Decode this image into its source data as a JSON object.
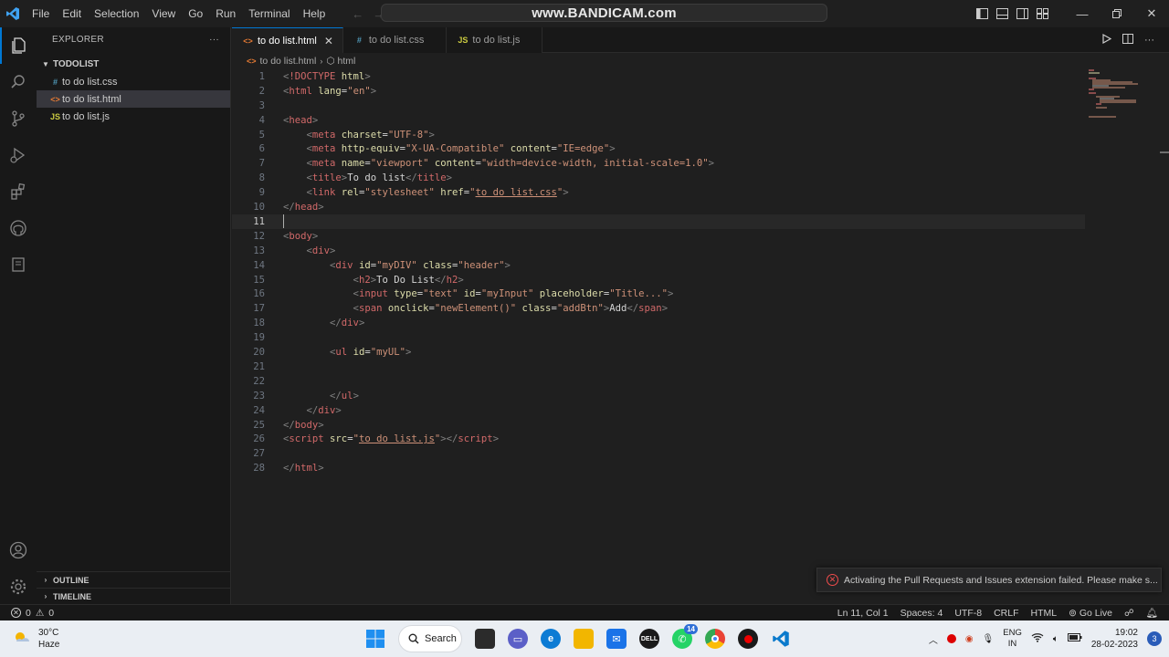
{
  "titlebar": {
    "menu": [
      "File",
      "Edit",
      "Selection",
      "View",
      "Go",
      "Run",
      "Terminal",
      "Help"
    ],
    "command_center": "www.BANDICAM.com"
  },
  "sidebar": {
    "title": "EXPLORER",
    "more": "···",
    "folder": "TODOLIST",
    "files": [
      {
        "name": "to do list.css",
        "type": "css",
        "icon": "#"
      },
      {
        "name": "to do list.html",
        "type": "html",
        "icon": "<>"
      },
      {
        "name": "to do list.js",
        "type": "js",
        "icon": "JS"
      }
    ],
    "outline": "OUTLINE",
    "timeline": "TIMELINE"
  },
  "tabs": [
    {
      "label": "to do list.html",
      "icon": "<>",
      "active": true
    },
    {
      "label": "to do list.css",
      "icon": "#",
      "active": false
    },
    {
      "label": "to do list.js",
      "icon": "JS",
      "active": false
    }
  ],
  "breadcrumb": {
    "file": "to do list.html",
    "node": "html"
  },
  "editor": {
    "current_line": 11,
    "lines": [
      {
        "n": "1",
        "tokens": [
          [
            "p",
            "<"
          ],
          [
            "d",
            "!DOCTYPE"
          ],
          [
            "a",
            " html"
          ],
          [
            "p",
            ">"
          ]
        ]
      },
      {
        "n": "2",
        "tokens": [
          [
            "p",
            "<"
          ],
          [
            "t",
            "html"
          ],
          [
            "a",
            " lang"
          ],
          [
            "x",
            "="
          ],
          [
            "s",
            "\"en\""
          ],
          [
            "p",
            ">"
          ]
        ]
      },
      {
        "n": "3",
        "tokens": []
      },
      {
        "n": "4",
        "tokens": [
          [
            "p",
            "<"
          ],
          [
            "t",
            "head"
          ],
          [
            "p",
            ">"
          ]
        ]
      },
      {
        "n": "5",
        "tokens": [
          [
            "x",
            "    "
          ],
          [
            "p",
            "<"
          ],
          [
            "t",
            "meta"
          ],
          [
            "a",
            " charset"
          ],
          [
            "x",
            "="
          ],
          [
            "s",
            "\"UTF-8\""
          ],
          [
            "p",
            ">"
          ]
        ]
      },
      {
        "n": "6",
        "tokens": [
          [
            "x",
            "    "
          ],
          [
            "p",
            "<"
          ],
          [
            "t",
            "meta"
          ],
          [
            "a",
            " http-equiv"
          ],
          [
            "x",
            "="
          ],
          [
            "s",
            "\"X-UA-Compatible\""
          ],
          [
            "a",
            " content"
          ],
          [
            "x",
            "="
          ],
          [
            "s",
            "\"IE=edge\""
          ],
          [
            "p",
            ">"
          ]
        ]
      },
      {
        "n": "7",
        "tokens": [
          [
            "x",
            "    "
          ],
          [
            "p",
            "<"
          ],
          [
            "t",
            "meta"
          ],
          [
            "a",
            " name"
          ],
          [
            "x",
            "="
          ],
          [
            "s",
            "\"viewport\""
          ],
          [
            "a",
            " content"
          ],
          [
            "x",
            "="
          ],
          [
            "s",
            "\"width=device-width, initial-scale=1.0\""
          ],
          [
            "p",
            ">"
          ]
        ]
      },
      {
        "n": "8",
        "tokens": [
          [
            "x",
            "    "
          ],
          [
            "p",
            "<"
          ],
          [
            "t",
            "title"
          ],
          [
            "p",
            ">"
          ],
          [
            "x",
            "To do list"
          ],
          [
            "p",
            "</"
          ],
          [
            "t",
            "title"
          ],
          [
            "p",
            ">"
          ]
        ]
      },
      {
        "n": "9",
        "tokens": [
          [
            "x",
            "    "
          ],
          [
            "p",
            "<"
          ],
          [
            "t",
            "link"
          ],
          [
            "a",
            " rel"
          ],
          [
            "x",
            "="
          ],
          [
            "s",
            "\"stylesheet\""
          ],
          [
            "a",
            " href"
          ],
          [
            "x",
            "="
          ],
          [
            "s",
            "\""
          ],
          [
            "u",
            "to do list.css"
          ],
          [
            "s",
            "\""
          ],
          [
            "p",
            ">"
          ]
        ]
      },
      {
        "n": "10",
        "tokens": [
          [
            "p",
            "</"
          ],
          [
            "t",
            "head"
          ],
          [
            "p",
            ">"
          ]
        ]
      },
      {
        "n": "11",
        "tokens": []
      },
      {
        "n": "12",
        "tokens": [
          [
            "p",
            "<"
          ],
          [
            "t",
            "body"
          ],
          [
            "p",
            ">"
          ]
        ]
      },
      {
        "n": "13",
        "tokens": [
          [
            "x",
            "    "
          ],
          [
            "p",
            "<"
          ],
          [
            "t",
            "div"
          ],
          [
            "p",
            ">"
          ]
        ]
      },
      {
        "n": "14",
        "tokens": [
          [
            "x",
            "        "
          ],
          [
            "p",
            "<"
          ],
          [
            "t",
            "div"
          ],
          [
            "a",
            " id"
          ],
          [
            "x",
            "="
          ],
          [
            "s",
            "\"myDIV\""
          ],
          [
            "a",
            " class"
          ],
          [
            "x",
            "="
          ],
          [
            "s",
            "\"header\""
          ],
          [
            "p",
            ">"
          ]
        ]
      },
      {
        "n": "15",
        "tokens": [
          [
            "x",
            "            "
          ],
          [
            "p",
            "<"
          ],
          [
            "t",
            "h2"
          ],
          [
            "p",
            ">"
          ],
          [
            "x",
            "To Do List"
          ],
          [
            "p",
            "</"
          ],
          [
            "t",
            "h2"
          ],
          [
            "p",
            ">"
          ]
        ]
      },
      {
        "n": "16",
        "tokens": [
          [
            "x",
            "            "
          ],
          [
            "p",
            "<"
          ],
          [
            "t",
            "input"
          ],
          [
            "a",
            " type"
          ],
          [
            "x",
            "="
          ],
          [
            "s",
            "\"text\""
          ],
          [
            "a",
            " id"
          ],
          [
            "x",
            "="
          ],
          [
            "s",
            "\"myInput\""
          ],
          [
            "a",
            " placeholder"
          ],
          [
            "x",
            "="
          ],
          [
            "s",
            "\"Title...\""
          ],
          [
            "p",
            ">"
          ]
        ]
      },
      {
        "n": "17",
        "tokens": [
          [
            "x",
            "            "
          ],
          [
            "p",
            "<"
          ],
          [
            "t",
            "span"
          ],
          [
            "a",
            " onclick"
          ],
          [
            "x",
            "="
          ],
          [
            "s",
            "\"newElement()\""
          ],
          [
            "a",
            " class"
          ],
          [
            "x",
            "="
          ],
          [
            "s",
            "\"addBtn\""
          ],
          [
            "p",
            ">"
          ],
          [
            "x",
            "Add"
          ],
          [
            "p",
            "</"
          ],
          [
            "t",
            "span"
          ],
          [
            "p",
            ">"
          ]
        ]
      },
      {
        "n": "18",
        "tokens": [
          [
            "x",
            "        "
          ],
          [
            "p",
            "</"
          ],
          [
            "t",
            "div"
          ],
          [
            "p",
            ">"
          ]
        ]
      },
      {
        "n": "19",
        "tokens": []
      },
      {
        "n": "20",
        "tokens": [
          [
            "x",
            "        "
          ],
          [
            "p",
            "<"
          ],
          [
            "t",
            "ul"
          ],
          [
            "a",
            " id"
          ],
          [
            "x",
            "="
          ],
          [
            "s",
            "\"myUL\""
          ],
          [
            "p",
            ">"
          ]
        ]
      },
      {
        "n": "21",
        "tokens": []
      },
      {
        "n": "22",
        "tokens": []
      },
      {
        "n": "23",
        "tokens": [
          [
            "x",
            "        "
          ],
          [
            "p",
            "</"
          ],
          [
            "t",
            "ul"
          ],
          [
            "p",
            ">"
          ]
        ]
      },
      {
        "n": "24",
        "tokens": [
          [
            "x",
            "    "
          ],
          [
            "p",
            "</"
          ],
          [
            "t",
            "div"
          ],
          [
            "p",
            ">"
          ]
        ]
      },
      {
        "n": "25",
        "tokens": [
          [
            "p",
            "</"
          ],
          [
            "t",
            "body"
          ],
          [
            "p",
            ">"
          ]
        ]
      },
      {
        "n": "26",
        "tokens": [
          [
            "p",
            "<"
          ],
          [
            "t",
            "script"
          ],
          [
            "a",
            " src"
          ],
          [
            "x",
            "="
          ],
          [
            "s",
            "\""
          ],
          [
            "u",
            "to do list.js"
          ],
          [
            "s",
            "\""
          ],
          [
            "p",
            "></"
          ],
          [
            "t",
            "script"
          ],
          [
            "p",
            ">"
          ]
        ]
      },
      {
        "n": "27",
        "tokens": []
      },
      {
        "n": "28",
        "tokens": [
          [
            "p",
            "</"
          ],
          [
            "t",
            "html"
          ],
          [
            "p",
            ">"
          ]
        ]
      }
    ]
  },
  "notification": {
    "text": "Activating the Pull Requests and Issues extension failed. Please make s..."
  },
  "statusbar": {
    "errors": "0",
    "warnings": "0",
    "position": "Ln 11, Col 1",
    "spaces": "Spaces: 4",
    "encoding": "UTF-8",
    "eol": "CRLF",
    "language": "HTML",
    "golive": "Go Live"
  },
  "taskbar": {
    "temperature": "30°C",
    "condition": "Haze",
    "search_label": "Search",
    "whatsapp_badge": "14",
    "lang_top": "ENG",
    "lang_bottom": "IN",
    "time": "19:02",
    "date": "28-02-2023",
    "notifications": "3"
  },
  "colors": {
    "accent": "#0078d4",
    "tag": "#d16969",
    "attribute": "#dcdcaa",
    "string": "#ce9178",
    "error": "#f14c4c"
  }
}
